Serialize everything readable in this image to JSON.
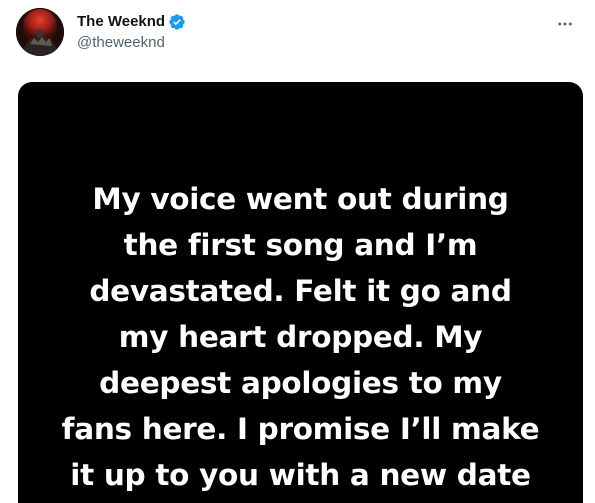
{
  "author": {
    "display_name": "The Weeknd",
    "handle": "@theweeknd",
    "verified": true,
    "avatar_icon": "profile-avatar",
    "verified_icon": "verified-badge-icon",
    "verified_color": "#1d9bf0"
  },
  "actions": {
    "more_icon": "more-options-icon"
  },
  "media": {
    "background_color": "#000000",
    "text_color": "#ffffff",
    "lines": [
      "My voice went out during",
      "the first song and I’m",
      "devastated. Felt it go and",
      "my heart dropped. My",
      "deepest apologies to my",
      "fans here. I promise I’ll make",
      "it up to you with a new date"
    ]
  }
}
